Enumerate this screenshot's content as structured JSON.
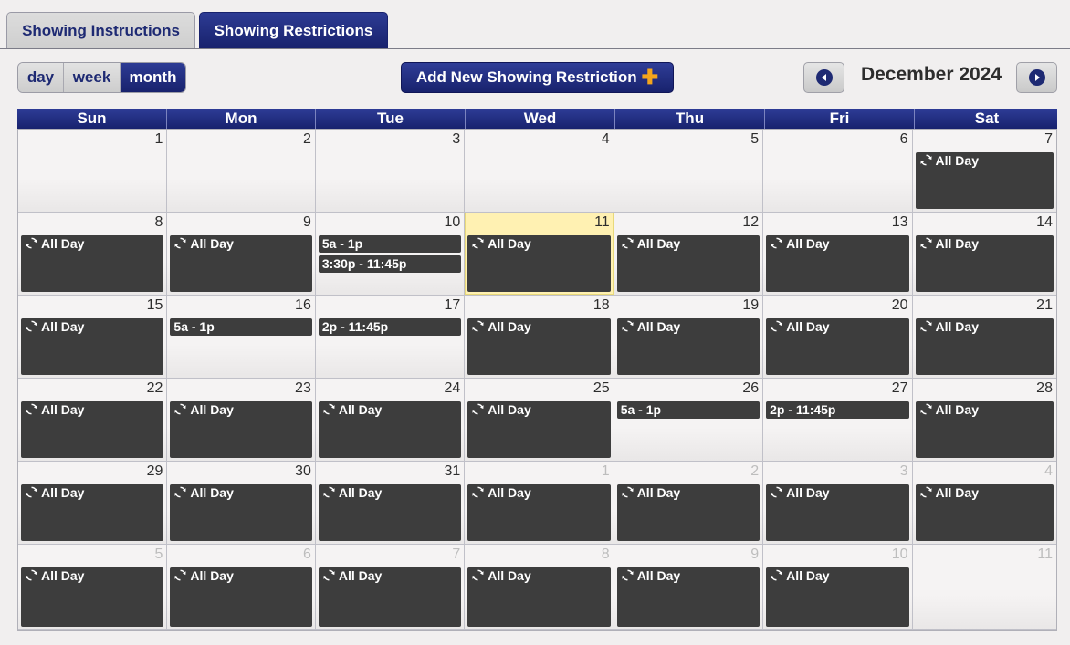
{
  "tabs": [
    {
      "label": "Showing Instructions",
      "active": false
    },
    {
      "label": "Showing Restrictions",
      "active": true
    }
  ],
  "toolbar": {
    "views": [
      {
        "label": "day",
        "active": false
      },
      {
        "label": "week",
        "active": false
      },
      {
        "label": "month",
        "active": true
      }
    ],
    "add_button_label": "Add New Showing Restriction",
    "add_button_icon": "plus-icon",
    "month_label": "December 2024",
    "prev_icon": "chevron-left-icon",
    "next_icon": "chevron-right-icon"
  },
  "calendar": {
    "weekdays": [
      "Sun",
      "Mon",
      "Tue",
      "Wed",
      "Thu",
      "Fri",
      "Sat"
    ],
    "weeks": [
      [
        {
          "day": "1",
          "other": false,
          "events": []
        },
        {
          "day": "2",
          "other": false,
          "events": []
        },
        {
          "day": "3",
          "other": false,
          "events": []
        },
        {
          "day": "4",
          "other": false,
          "events": []
        },
        {
          "day": "5",
          "other": false,
          "events": []
        },
        {
          "day": "6",
          "other": false,
          "events": []
        },
        {
          "day": "7",
          "other": false,
          "events": [
            {
              "label": "All Day",
              "recurring": true
            }
          ]
        }
      ],
      [
        {
          "day": "8",
          "other": false,
          "events": [
            {
              "label": "All Day",
              "recurring": true
            }
          ]
        },
        {
          "day": "9",
          "other": false,
          "events": [
            {
              "label": "All Day",
              "recurring": true
            }
          ]
        },
        {
          "day": "10",
          "other": false,
          "events": [
            {
              "label": "5a - 1p",
              "recurring": false
            },
            {
              "label": "3:30p - 11:45p",
              "recurring": false
            }
          ]
        },
        {
          "day": "11",
          "other": false,
          "today": true,
          "events": [
            {
              "label": "All Day",
              "recurring": true
            }
          ]
        },
        {
          "day": "12",
          "other": false,
          "events": [
            {
              "label": "All Day",
              "recurring": true
            }
          ]
        },
        {
          "day": "13",
          "other": false,
          "events": [
            {
              "label": "All Day",
              "recurring": true
            }
          ]
        },
        {
          "day": "14",
          "other": false,
          "events": [
            {
              "label": "All Day",
              "recurring": true
            }
          ]
        }
      ],
      [
        {
          "day": "15",
          "other": false,
          "events": [
            {
              "label": "All Day",
              "recurring": true
            }
          ]
        },
        {
          "day": "16",
          "other": false,
          "events": [
            {
              "label": "5a - 1p",
              "recurring": false
            }
          ]
        },
        {
          "day": "17",
          "other": false,
          "events": [
            {
              "label": "2p - 11:45p",
              "recurring": false
            }
          ]
        },
        {
          "day": "18",
          "other": false,
          "events": [
            {
              "label": "All Day",
              "recurring": true
            }
          ]
        },
        {
          "day": "19",
          "other": false,
          "events": [
            {
              "label": "All Day",
              "recurring": true
            }
          ]
        },
        {
          "day": "20",
          "other": false,
          "events": [
            {
              "label": "All Day",
              "recurring": true
            }
          ]
        },
        {
          "day": "21",
          "other": false,
          "events": [
            {
              "label": "All Day",
              "recurring": true
            }
          ]
        }
      ],
      [
        {
          "day": "22",
          "other": false,
          "events": [
            {
              "label": "All Day",
              "recurring": true
            }
          ]
        },
        {
          "day": "23",
          "other": false,
          "events": [
            {
              "label": "All Day",
              "recurring": true
            }
          ]
        },
        {
          "day": "24",
          "other": false,
          "events": [
            {
              "label": "All Day",
              "recurring": true
            }
          ]
        },
        {
          "day": "25",
          "other": false,
          "events": [
            {
              "label": "All Day",
              "recurring": true
            }
          ]
        },
        {
          "day": "26",
          "other": false,
          "events": [
            {
              "label": "5a - 1p",
              "recurring": false
            }
          ]
        },
        {
          "day": "27",
          "other": false,
          "events": [
            {
              "label": "2p - 11:45p",
              "recurring": false
            }
          ]
        },
        {
          "day": "28",
          "other": false,
          "events": [
            {
              "label": "All Day",
              "recurring": true
            }
          ]
        }
      ],
      [
        {
          "day": "29",
          "other": false,
          "events": [
            {
              "label": "All Day",
              "recurring": true
            }
          ]
        },
        {
          "day": "30",
          "other": false,
          "events": [
            {
              "label": "All Day",
              "recurring": true
            }
          ]
        },
        {
          "day": "31",
          "other": false,
          "events": [
            {
              "label": "All Day",
              "recurring": true
            }
          ]
        },
        {
          "day": "1",
          "other": true,
          "events": [
            {
              "label": "All Day",
              "recurring": true
            }
          ]
        },
        {
          "day": "2",
          "other": true,
          "events": [
            {
              "label": "All Day",
              "recurring": true
            }
          ]
        },
        {
          "day": "3",
          "other": true,
          "events": [
            {
              "label": "All Day",
              "recurring": true
            }
          ]
        },
        {
          "day": "4",
          "other": true,
          "events": [
            {
              "label": "All Day",
              "recurring": true
            }
          ]
        }
      ],
      [
        {
          "day": "5",
          "other": true,
          "events": [
            {
              "label": "All Day",
              "recurring": true
            }
          ]
        },
        {
          "day": "6",
          "other": true,
          "events": [
            {
              "label": "All Day",
              "recurring": true
            }
          ]
        },
        {
          "day": "7",
          "other": true,
          "events": [
            {
              "label": "All Day",
              "recurring": true
            }
          ]
        },
        {
          "day": "8",
          "other": true,
          "events": [
            {
              "label": "All Day",
              "recurring": true
            }
          ]
        },
        {
          "day": "9",
          "other": true,
          "events": [
            {
              "label": "All Day",
              "recurring": true
            }
          ]
        },
        {
          "day": "10",
          "other": true,
          "events": [
            {
              "label": "All Day",
              "recurring": true
            }
          ]
        },
        {
          "day": "11",
          "other": true,
          "events": []
        }
      ]
    ]
  }
}
